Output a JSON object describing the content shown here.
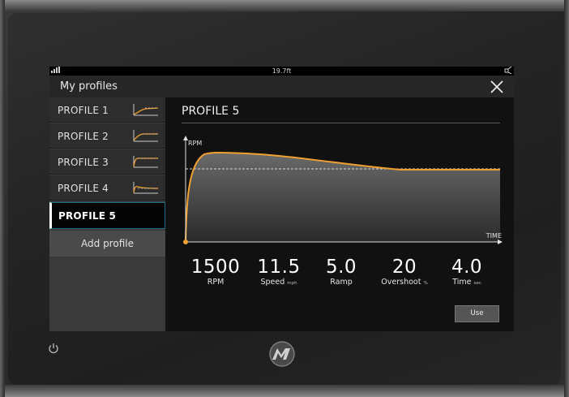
{
  "status": {
    "depth": "19.7ft"
  },
  "dialog": {
    "title": "My profiles"
  },
  "profiles": [
    {
      "label": "PROFILE 1",
      "icon": "profile-curve-icon"
    },
    {
      "label": "PROFILE 2",
      "icon": "profile-curve-icon"
    },
    {
      "label": "PROFILE 3",
      "icon": "profile-curve-icon"
    },
    {
      "label": "PROFILE 4",
      "icon": "profile-curve-icon"
    },
    {
      "label": "PROFILE 5",
      "icon": "profile-curve-icon",
      "selected": true
    }
  ],
  "add_profile_label": "Add profile",
  "detail": {
    "title": "PROFILE 5",
    "chart": {
      "y_label": "RPM",
      "x_label": "TIME"
    },
    "stats": [
      {
        "value": "1500",
        "label": "RPM",
        "unit": ""
      },
      {
        "value": "11.5",
        "label": "Speed",
        "unit": "mph"
      },
      {
        "value": "5.0",
        "label": "Ramp",
        "unit": ""
      },
      {
        "value": "20",
        "label": "Overshoot",
        "unit": "%"
      },
      {
        "value": "4.0",
        "label": "Time",
        "unit": "sec"
      }
    ],
    "use_label": "Use"
  },
  "colors": {
    "accent": "#f0a030",
    "selection_border": "#1c6c8c"
  }
}
